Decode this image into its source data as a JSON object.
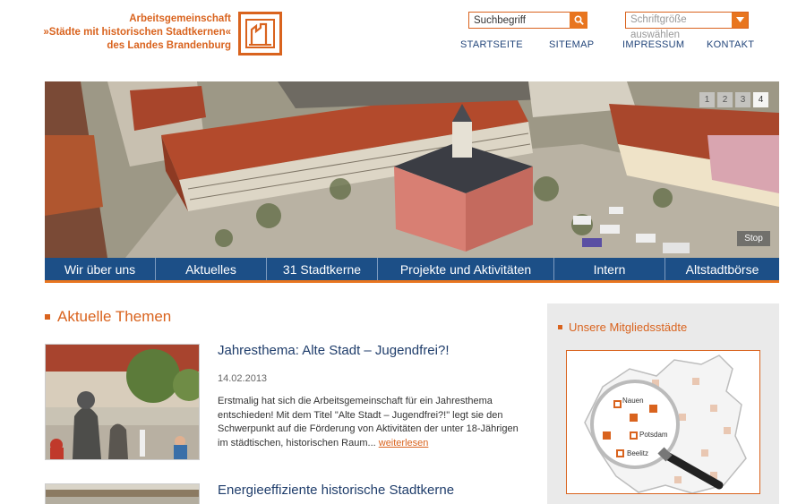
{
  "header": {
    "logo_lines": [
      "Arbeitsgemeinschaft",
      "»Städte mit historischen Stadtkernen«",
      "des Landes Brandenburg"
    ],
    "search_placeholder": "Suchbegriff",
    "font_size_label": "Schriftgröße auswählen",
    "top_nav": [
      "STARTSEITE",
      "SITEMAP",
      "IMPRESSUM",
      "KONTAKT"
    ]
  },
  "hero": {
    "pager": [
      "1",
      "2",
      "3",
      "4"
    ],
    "active_page": "4",
    "stop_label": "Stop"
  },
  "main_nav": [
    "Wir über uns",
    "Aktuelles",
    "31 Stadtkerne",
    "Projekte und Aktivitäten",
    "Intern",
    "Altstadtbörse"
  ],
  "content": {
    "section_title": "Aktuelle Themen",
    "articles": [
      {
        "title": "Jahresthema: Alte Stadt – Jugendfrei?!",
        "date": "14.02.2013",
        "text": "Erstmalig hat sich die Arbeitsgemeinschaft für ein Jahresthema entschieden! Mit dem Titel \"Alte Stadt – Jugendfrei?!\" legt sie den Schwerpunkt auf die Förderung von Aktivitäten der unter 18-Jährigen im städtischen, historischen Raum...",
        "more": "weiterlesen"
      },
      {
        "title": "Energieeffiziente historische Stadtkerne"
      }
    ]
  },
  "sidebar": {
    "title": "Unsere Mitgliedsstädte",
    "map_labels": [
      "Nauen",
      "Potsdam",
      "Beelitz"
    ]
  },
  "colors": {
    "accent": "#e8751f",
    "brand_blue": "#1c4f87",
    "link_blue": "#22457a"
  }
}
